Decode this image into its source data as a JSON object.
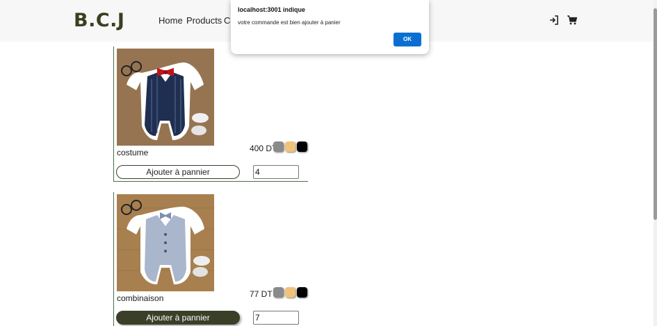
{
  "navbar": {
    "brand": "B.C.J",
    "links": [
      "Home",
      "Products",
      "Co"
    ],
    "icons": [
      "login-icon",
      "cart-icon"
    ]
  },
  "products": [
    {
      "name": "costume",
      "price": "400 DT",
      "quantity": "4",
      "add_label": "Ajouter à pannier",
      "add_style": "outline",
      "image": "baby-navy-vest-romper-image",
      "swatches": [
        "#8a8a8a",
        "#f0c27a",
        "#000000"
      ]
    },
    {
      "name": "combinaison",
      "price": "77 DT",
      "quantity": "7",
      "add_label": "Ajouter à pannier",
      "add_style": "filled",
      "image": "baby-grey-vest-romper-image",
      "swatches": [
        "#8a8a8a",
        "#f0c27a",
        "#000000"
      ]
    }
  ],
  "dialog": {
    "title": "localhost:3001 indique",
    "message": "votre commande est bien ajouter à panier",
    "ok_label": "OK"
  },
  "colors": {
    "brand": "#3a3f1f",
    "button_dark": "#3a3f28",
    "dialog_ok": "#0b6fd1"
  }
}
